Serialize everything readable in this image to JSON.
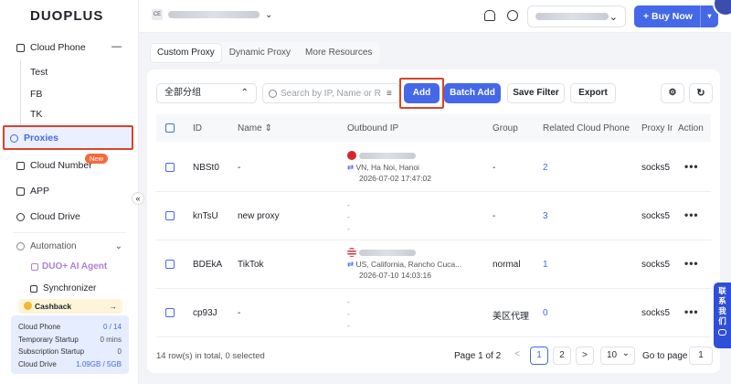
{
  "app": {
    "logo": "DUOPLUS"
  },
  "sidebar": {
    "cloud_phone": "Cloud Phone",
    "cloud_phone_toggle": "—",
    "groups": [
      "Test",
      "FB",
      "TK"
    ],
    "proxies": "Proxies",
    "cloud_number": "Cloud Number",
    "new_badge": "New",
    "app": "APP",
    "cloud_drive": "Cloud Drive",
    "automation": "Automation",
    "ai_agent": "DUO+ AI Agent",
    "synchronizer": "Synchronizer",
    "cashback": "Cashback",
    "cashback_arrow": "→",
    "collapse": "«",
    "usage": [
      {
        "label": "Cloud Phone",
        "value": "0 / 14",
        "accent": true
      },
      {
        "label": "Temporary Startup",
        "value": "0 mins",
        "accent": false
      },
      {
        "label": "Subscription Startup",
        "value": "0",
        "accent": false
      },
      {
        "label": "Cloud Drive",
        "value": "1.09GB / 5GB",
        "accent": true
      }
    ]
  },
  "topbar": {
    "account_initials": "CE",
    "account_chevron": "⌄",
    "buy_now": "+ Buy Now",
    "buy_split": "▾"
  },
  "tabs": [
    "Custom Proxy",
    "Dynamic Proxy",
    "More Resources"
  ],
  "toolbar": {
    "group_select": "全部分组",
    "group_chevron": "⌃",
    "search_placeholder": "Search by IP, Name or R",
    "add": "Add",
    "batch_add": "Batch Add",
    "save_filter": "Save Filter",
    "export": "Export"
  },
  "table": {
    "headers": [
      "ID",
      "Name ⇕",
      "Outbound IP",
      "Group",
      "Related Cloud Phone",
      "Proxy In",
      "Action"
    ],
    "rows": [
      {
        "id": "NBSt0",
        "name": "-",
        "flag": "vn",
        "location": "VN, Ha Noi, Hanoi",
        "time": "2026-07-02 17:47:02",
        "group": "-",
        "related": "2",
        "proxy": "socks5",
        "action": "•••"
      },
      {
        "id": "knTsU",
        "name": "new proxy",
        "flag": "",
        "location": "",
        "time": "",
        "group": "-",
        "related": "3",
        "proxy": "socks5",
        "action": "•••"
      },
      {
        "id": "BDEkA",
        "name": "TikTok",
        "flag": "us",
        "location": "US, California, Rancho Cuca...",
        "time": "2026-07-10 14:03:16",
        "group": "normal",
        "related": "1",
        "proxy": "socks5",
        "action": "•••"
      },
      {
        "id": "cp93J",
        "name": "-",
        "flag": "",
        "location": "",
        "time": "",
        "group": "美区代理",
        "related": "0",
        "proxy": "socks5",
        "action": "•••"
      }
    ],
    "dash": "-"
  },
  "footer": {
    "summary": "14 row(s) in total, 0 selected",
    "page_info": "Page 1 of 2",
    "prev": "<",
    "next": ">",
    "pages": [
      "1",
      "2"
    ],
    "page_size": "10",
    "page_size_chevron": "⌄",
    "goto_label": "Go to page",
    "goto_value": "1"
  },
  "contact": "联系我们",
  "colors": {
    "primary": "#4468e8",
    "highlight": "#d9442c"
  }
}
